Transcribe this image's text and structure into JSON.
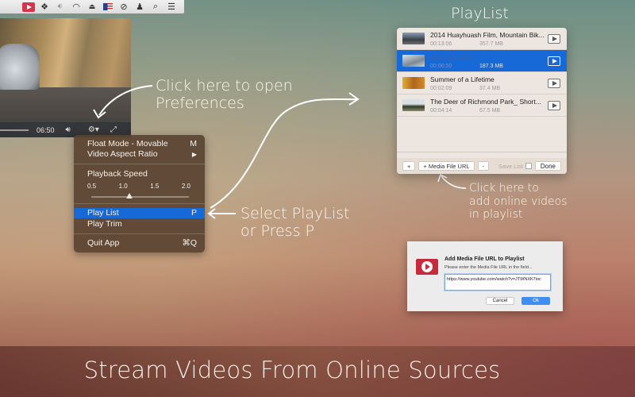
{
  "menubar": {
    "icons": [
      "app-icon",
      "dropbox-icon",
      "volume-icon",
      "wifi-icon",
      "eject-icon",
      "us-flag-icon",
      "safari-compass-icon",
      "user-icon",
      "spotlight-search-icon",
      "notification-list-icon"
    ]
  },
  "player": {
    "time": "06:50"
  },
  "settings_menu": {
    "float_mode": {
      "label": "Float Mode - Movable",
      "shortcut": "M"
    },
    "aspect_ratio": {
      "label": "Video Aspect Ratio",
      "shortcut": "▶"
    },
    "playback_speed": {
      "label": "Playback Speed",
      "ticks": [
        "0.5",
        "1.0",
        "1.5",
        "2.0"
      ],
      "value": 1.0
    },
    "play_list": {
      "label": "Play List",
      "shortcut": "P"
    },
    "play_trim": {
      "label": "Play Trim"
    },
    "quit": {
      "label": "Quit App",
      "shortcut": "⌘Q"
    }
  },
  "annotations": {
    "preferences_line1": "Click here to open",
    "preferences_line2": "Preferences",
    "playlist_line1": "Select PlayList",
    "playlist_line2": "or Press P",
    "online_line1": "Click here to",
    "online_line2": "add online videos",
    "online_line3": "in playlist"
  },
  "playlist": {
    "title": "PlayList",
    "items": [
      {
        "name": "2014 Huayhuash Film, Mountain Bik...",
        "duration": "00:13:06",
        "size": "357.7 MB",
        "selected": false
      },
      {
        "name": "BMW i8 review",
        "duration": "00:06:50",
        "size": "187.3 MB",
        "selected": true
      },
      {
        "name": "Summer of a Lifetime",
        "duration": "00:02:09",
        "size": "37.4 MB",
        "selected": false
      },
      {
        "name": "The Deer of Richmond Park_ Short...",
        "duration": "00:04:14",
        "size": "67.5 MB",
        "selected": false
      }
    ],
    "add_label": "+",
    "add_url_label": "+ Media File URL",
    "remove_label": "-",
    "save_list_label": "Save List",
    "done_label": "Done"
  },
  "dialog": {
    "title": "Add Media File URL to Playlist",
    "subtitle": "Please enter the Media File URL in the field...",
    "url_value": "https://www.youtube.com/watch?v=JTWNXK7ioc",
    "cancel_label": "Cancel",
    "ok_label": "Ok"
  },
  "banner": {
    "text": "Stream Videos From Online Sources"
  }
}
